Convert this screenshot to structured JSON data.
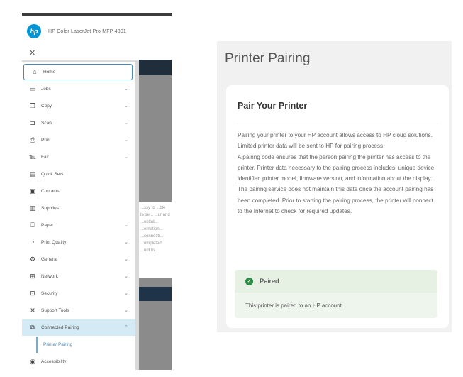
{
  "device": {
    "logo_text": "hp",
    "title": "HP Color LaserJet Pro MFP 4301"
  },
  "background_text": "...ssy to ...ble to se... ...ur and ...ected... ...ernation... ...connecti... ...ompleted... ...not to...",
  "nav": {
    "items": [
      {
        "label": "Home",
        "icon": "house-icon",
        "chevron": false
      },
      {
        "label": "Jobs",
        "icon": "printer-icon",
        "chevron": true
      },
      {
        "label": "Copy",
        "icon": "copy-icon",
        "chevron": true
      },
      {
        "label": "Scan",
        "icon": "scan-icon",
        "chevron": true
      },
      {
        "label": "Print",
        "icon": "print-icon",
        "chevron": true
      },
      {
        "label": "Fax",
        "icon": "fax-icon",
        "chevron": true
      },
      {
        "label": "Quick Sets",
        "icon": "quick-sets-icon",
        "chevron": false
      },
      {
        "label": "Contacts",
        "icon": "contacts-icon",
        "chevron": false
      },
      {
        "label": "Supplies",
        "icon": "supplies-icon",
        "chevron": false
      },
      {
        "label": "Paper",
        "icon": "paper-icon",
        "chevron": true
      },
      {
        "label": "Print Quality",
        "icon": "print-quality-icon",
        "chevron": true
      },
      {
        "label": "General",
        "icon": "general-icon",
        "chevron": true
      },
      {
        "label": "Network",
        "icon": "network-icon",
        "chevron": true
      },
      {
        "label": "Security",
        "icon": "security-icon",
        "chevron": true
      },
      {
        "label": "Support Tools",
        "icon": "support-tools-icon",
        "chevron": true
      },
      {
        "label": "Connected Pairing",
        "icon": "connected-pairing-icon",
        "chevron": true
      },
      {
        "label": "Printer Pairing",
        "icon": "",
        "chevron": false
      },
      {
        "label": "Accessibility",
        "icon": "accessibility-icon",
        "chevron": false
      }
    ]
  },
  "page": {
    "title": "Printer Pairing",
    "card_title": "Pair Your Printer",
    "paragraph1": "Pairing your printer to your HP account allows access to HP cloud solutions. Limited printer data will be sent to HP for pairing process.",
    "paragraph2": "A pairing code ensures that the person pairing the printer has access to the printer. Printer data necessary to the pairing process includes: unique device identifier, printer model, firmware version, and information about the display. The pairing service does not maintain this data once the account pairing has been completed. Prior to starting the pairing process, the printer will connect to the Internet to check for required updates.",
    "status_label": "Paired",
    "status_detail": "This printer is paired to an HP account."
  },
  "colors": {
    "hp_blue": "#0096d6",
    "active_bg": "#d4eaf5",
    "paired_green": "#2e8b47"
  }
}
